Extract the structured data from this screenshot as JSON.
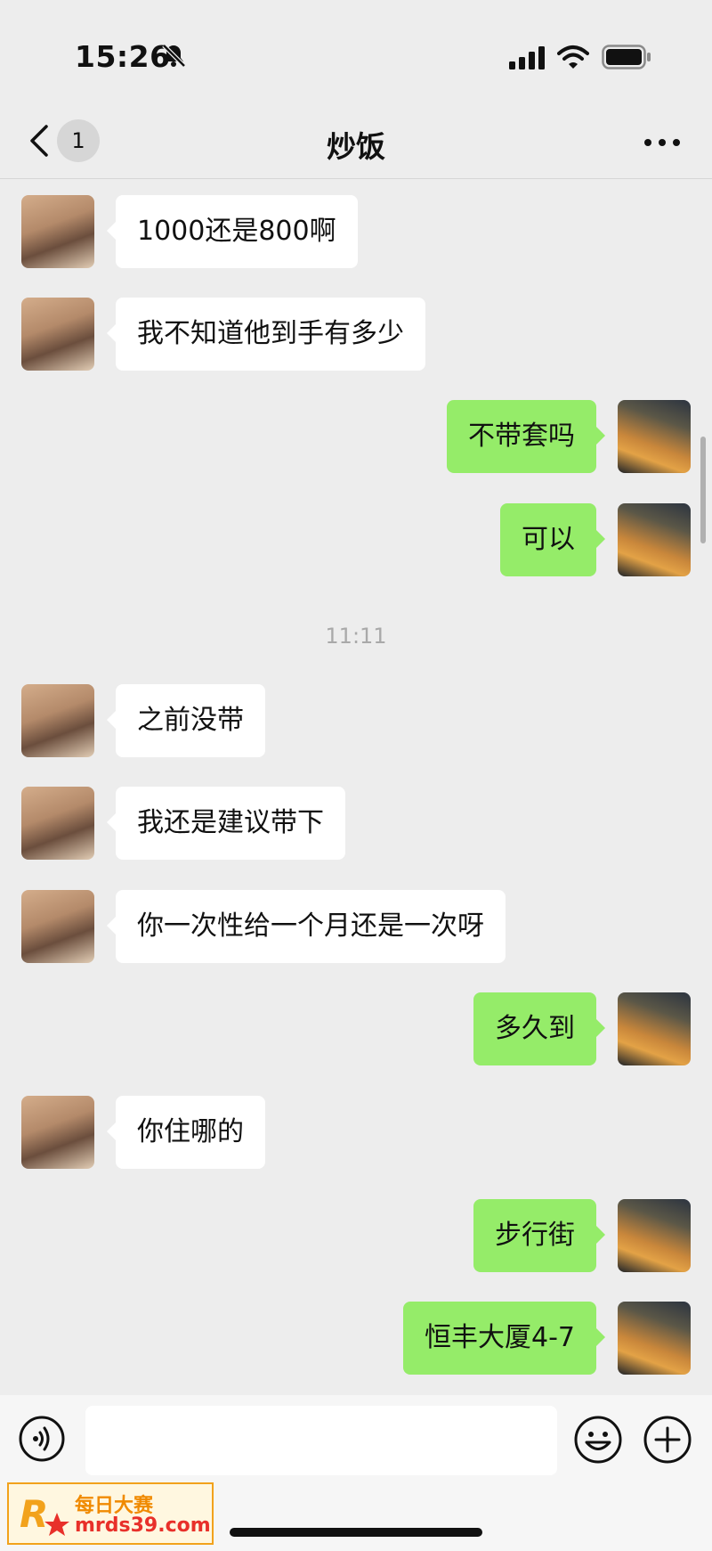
{
  "status_bar": {
    "time": "15:26"
  },
  "nav": {
    "unread_count": "1",
    "title": "炒饭"
  },
  "messages": [
    {
      "side": "left",
      "text": "1000还是800啊"
    },
    {
      "side": "left",
      "text": "我不知道他到手有多少"
    },
    {
      "side": "right",
      "text": "不带套吗"
    },
    {
      "side": "right",
      "text": "可以"
    },
    {
      "side": "left",
      "text": "之前没带"
    },
    {
      "side": "left",
      "text": "我还是建议带下"
    },
    {
      "side": "left",
      "text": "你一次性给一个月还是一次呀"
    },
    {
      "side": "right",
      "text": "多久到"
    },
    {
      "side": "left",
      "text": "你住哪的"
    },
    {
      "side": "right",
      "text": "步行街"
    },
    {
      "side": "right",
      "text": "恒丰大厦4-7"
    }
  ],
  "timestamp": "11:11",
  "input": {
    "value": ""
  },
  "watermark": {
    "line1": "每日大赛",
    "line2": "mrds39.com"
  },
  "colors": {
    "background": "#ededed",
    "bubble_self": "#95ec69",
    "bubble_other": "#ffffff",
    "timestamp": "#a9a9a9"
  },
  "icons": [
    "bell-slash-icon",
    "signal-icon",
    "wifi-icon",
    "battery-icon",
    "back-chevron-icon",
    "more-dots-icon",
    "voice-icon",
    "emoji-icon",
    "plus-icon"
  ]
}
